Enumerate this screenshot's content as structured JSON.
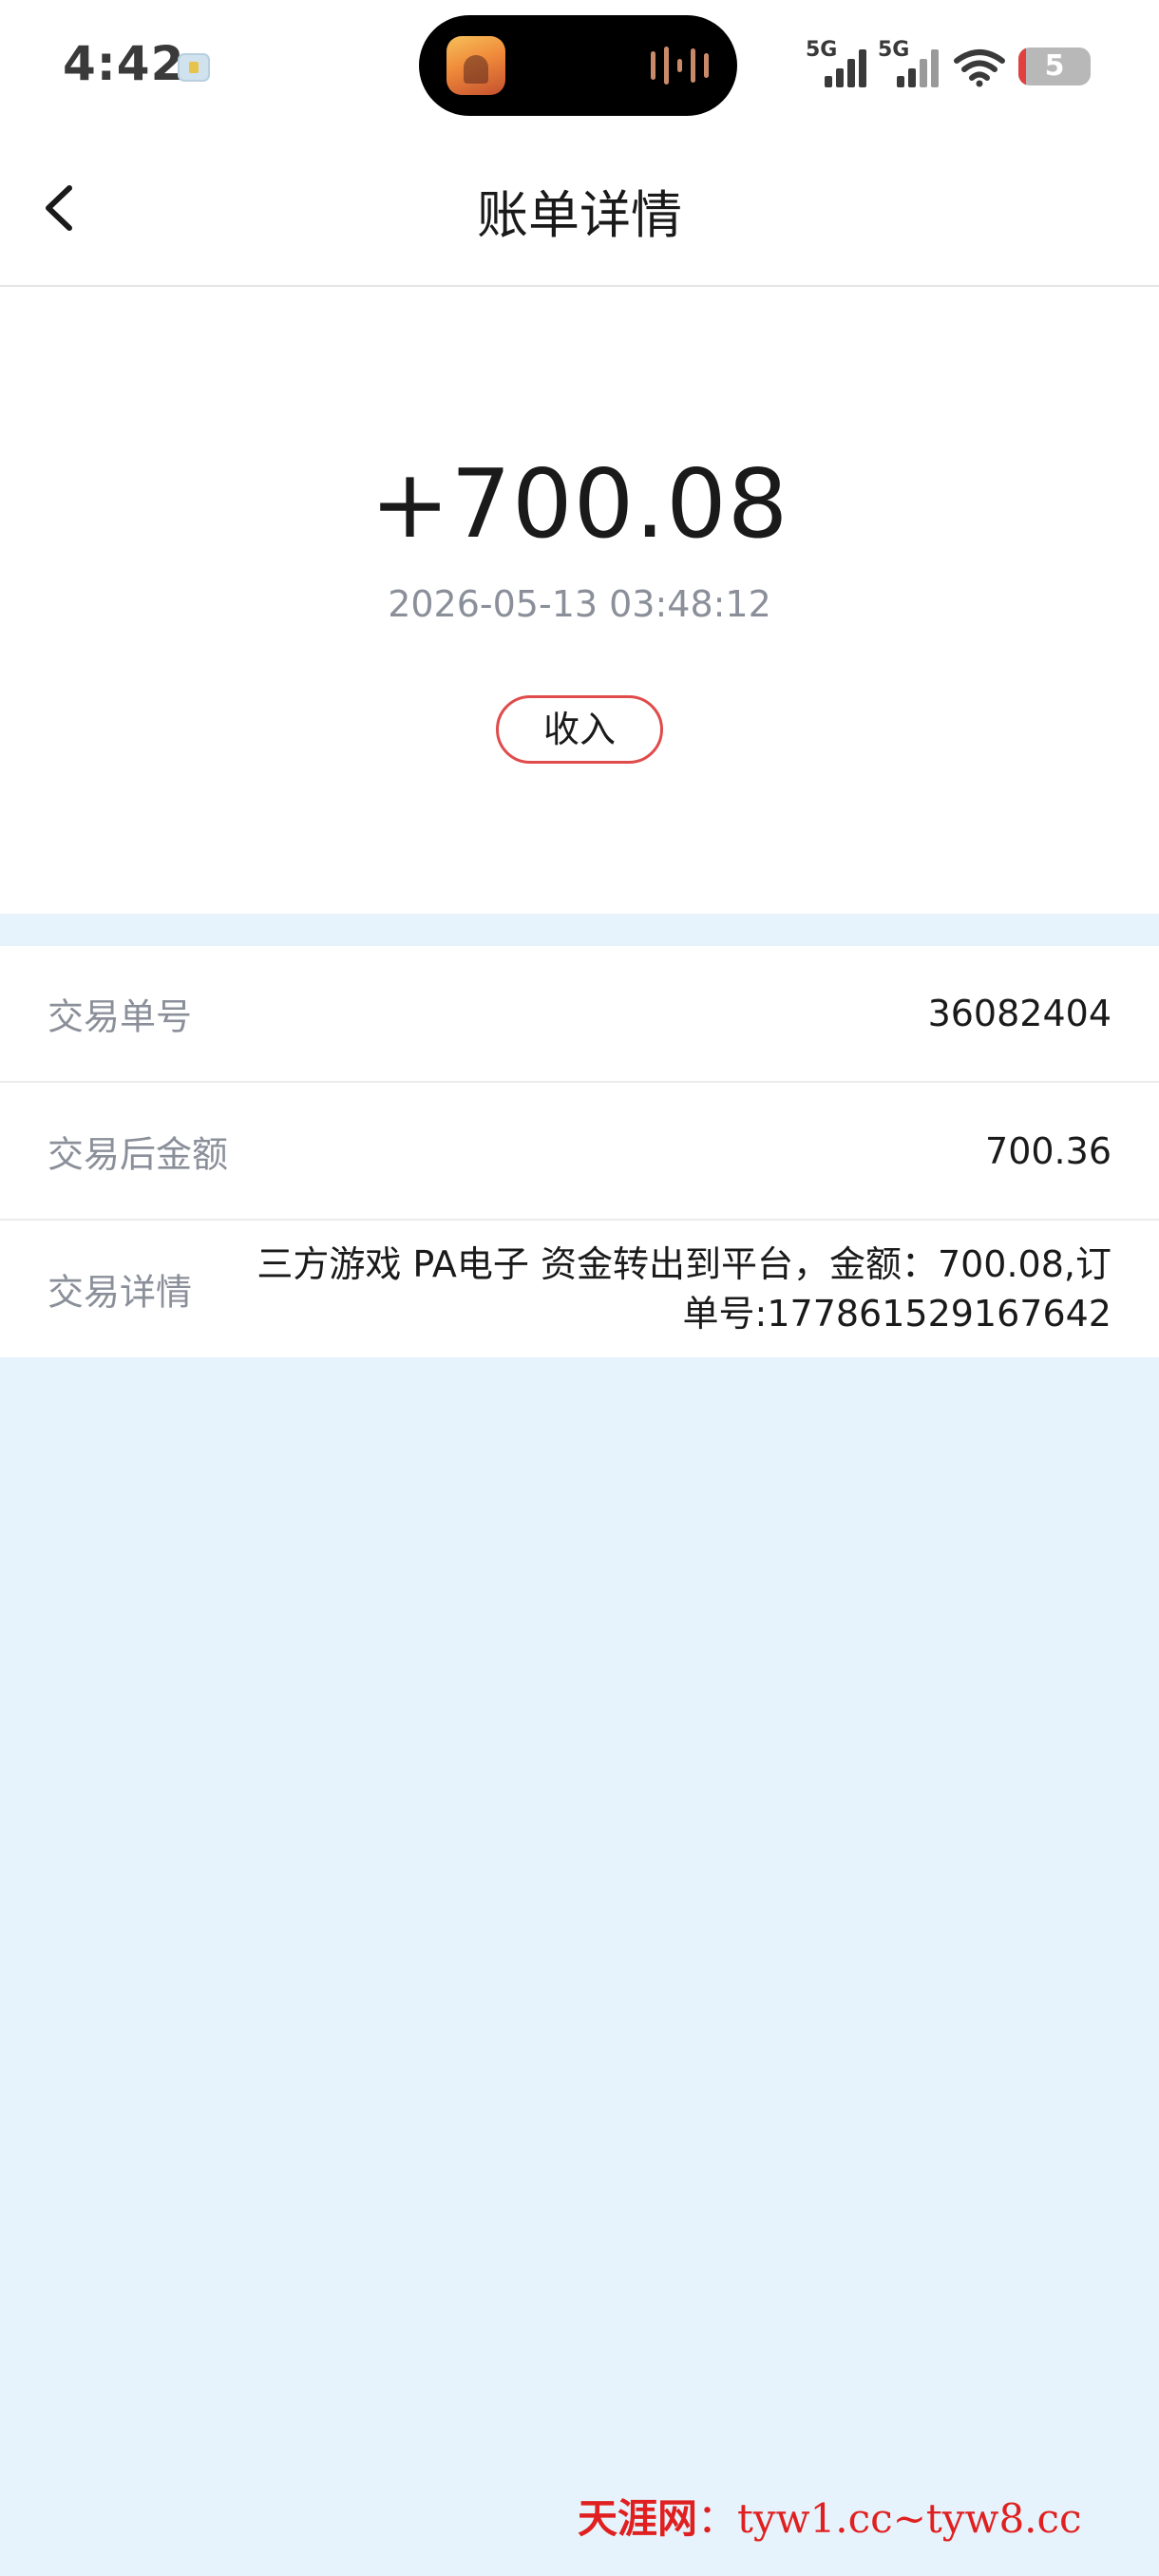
{
  "status_bar": {
    "time": "4:42",
    "network_1": "5G",
    "network_2": "5G",
    "battery_level": "5",
    "icons": [
      "notification-icon",
      "wifi-icon",
      "battery-icon"
    ]
  },
  "nav": {
    "title": "账单详情"
  },
  "summary": {
    "amount": "+700.08",
    "datetime": "2026-05-13 03:48:12",
    "type_label": "收入"
  },
  "details": {
    "order_no_label": "交易单号",
    "order_no_value": "36082404",
    "balance_after_label": "交易后金额",
    "balance_after_value": "700.36",
    "detail_label": "交易详情",
    "detail_value": "三方游戏 PA电子 资金转出到平台，金额：700.08,订单号:177861529167642"
  },
  "watermark": {
    "brand": "天涯网",
    "sep": "：",
    "urls": "tyw1.cc~tyw8.cc"
  },
  "colors": {
    "accent_red": "#e04b4b",
    "page_bg": "#e6f3fc",
    "label_gray": "#8a8f99"
  }
}
